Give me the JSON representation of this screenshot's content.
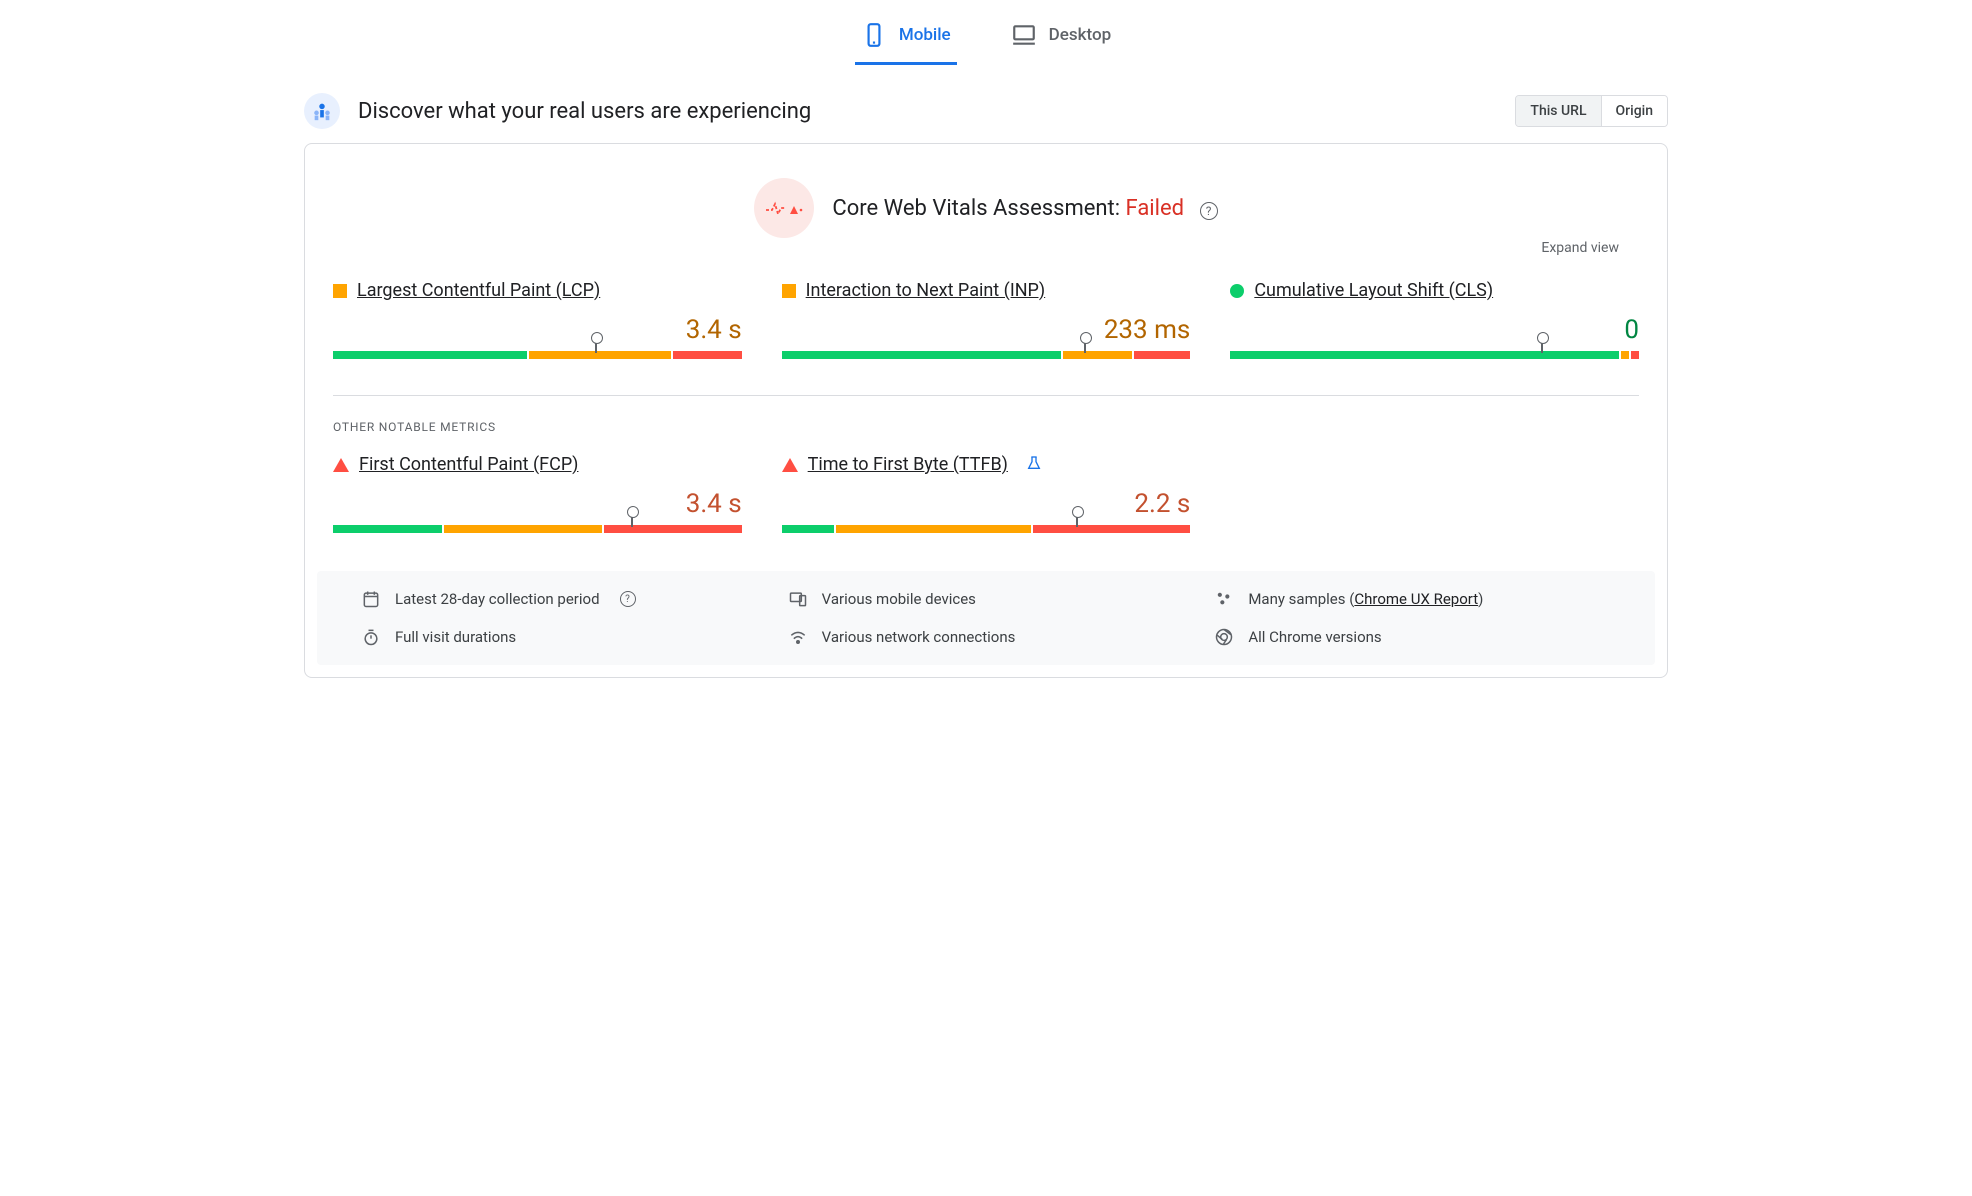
{
  "tabs": {
    "mobile": "Mobile",
    "desktop": "Desktop",
    "active": "mobile"
  },
  "header": {
    "title": "Discover what your real users are experiencing",
    "seg_this_url": "This URL",
    "seg_origin": "Origin"
  },
  "assessment": {
    "label": "Core Web Vitals Assessment:",
    "status": "Failed",
    "expand": "Expand view"
  },
  "core_metrics": [
    {
      "name": "Largest Contentful Paint (LCP)",
      "value": "3.4 s",
      "shape": "square",
      "tone": "orange",
      "bars": [
        48,
        35,
        17
      ],
      "marker": 64
    },
    {
      "name": "Interaction to Next Paint (INP)",
      "value": "233 ms",
      "shape": "square",
      "tone": "orange",
      "bars": [
        69,
        17,
        14
      ],
      "marker": 74
    },
    {
      "name": "Cumulative Layout Shift (CLS)",
      "value": "0",
      "shape": "circle",
      "tone": "green",
      "bars": [
        96,
        2,
        2
      ],
      "marker": 76
    }
  ],
  "other_label": "OTHER NOTABLE METRICS",
  "other_metrics": [
    {
      "name": "First Contentful Paint (FCP)",
      "value": "3.4 s",
      "shape": "triangle",
      "tone": "red",
      "bars": [
        27,
        39,
        34
      ],
      "marker": 73,
      "flask": false
    },
    {
      "name": "Time to First Byte (TTFB)",
      "value": "2.2 s",
      "shape": "triangle",
      "tone": "red",
      "bars": [
        13,
        48,
        39
      ],
      "marker": 72,
      "flask": true
    }
  ],
  "info": {
    "period": "Latest 28-day collection period",
    "devices": "Various mobile devices",
    "samples_pre": "Many samples (",
    "samples_link": "Chrome UX Report",
    "samples_post": ")",
    "durations": "Full visit durations",
    "network": "Various network connections",
    "chrome": "All Chrome versions"
  }
}
